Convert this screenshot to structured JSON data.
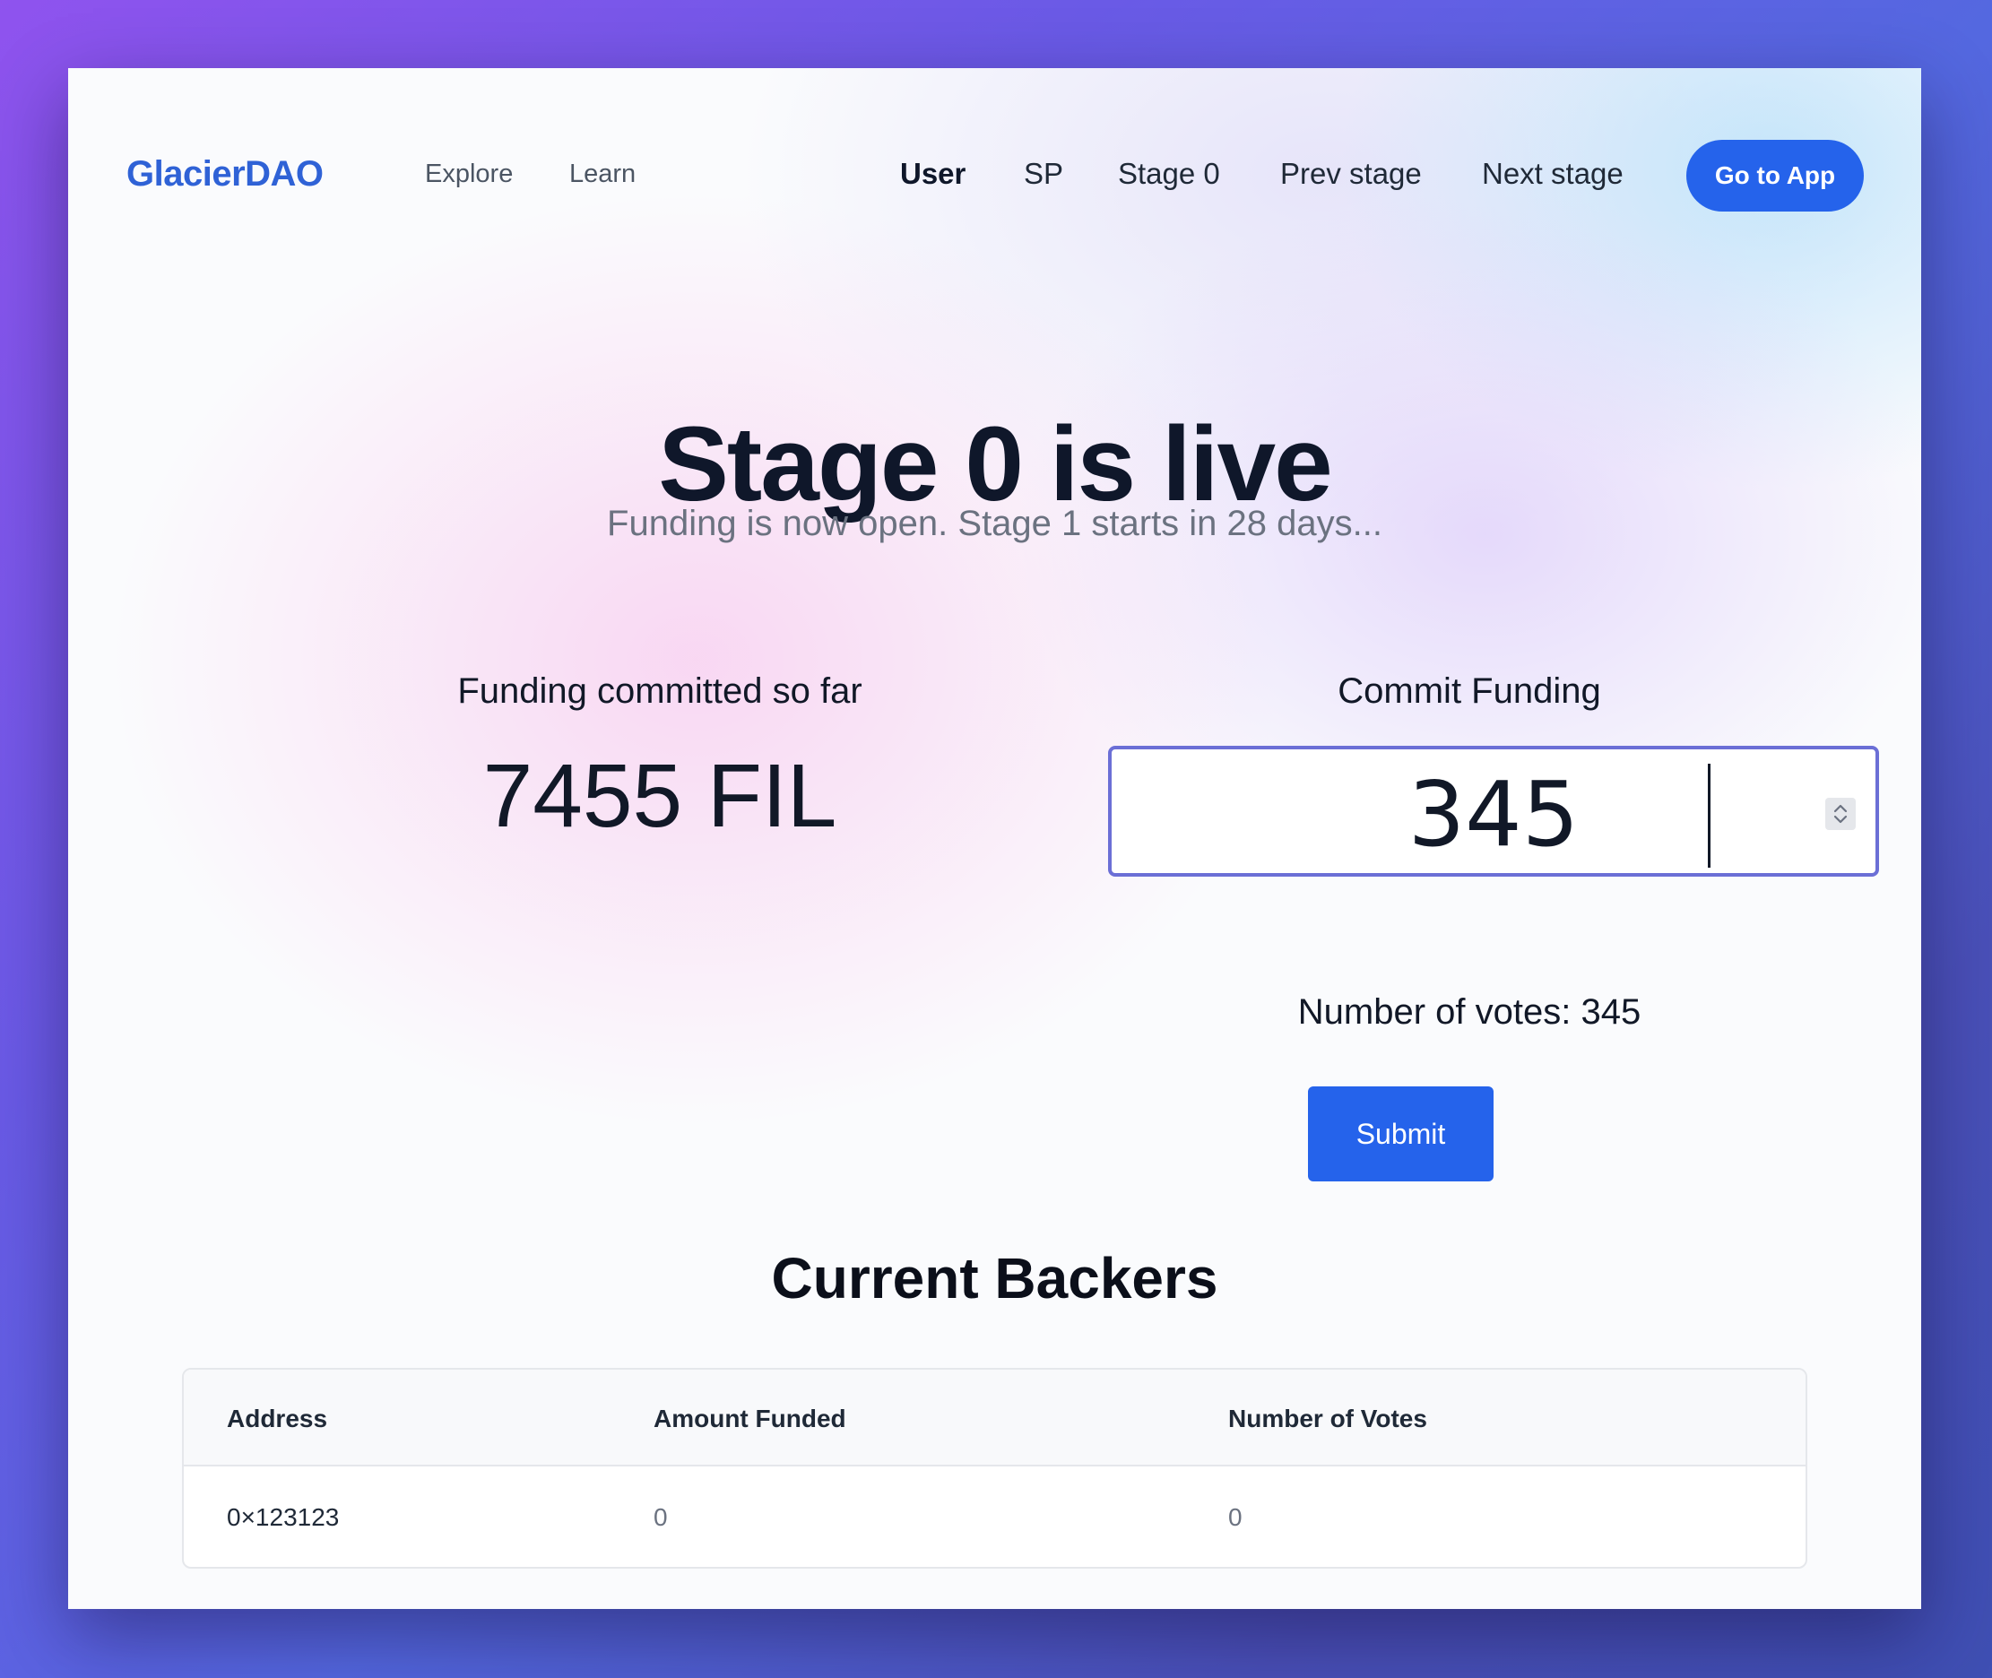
{
  "brand": "GlacierDAO",
  "nav": {
    "left_links": [
      "Explore",
      "Learn"
    ],
    "right_links": [
      "User",
      "SP",
      "Stage 0",
      "Prev stage",
      "Next stage"
    ],
    "active": "User",
    "cta": "Go to App"
  },
  "hero": {
    "title": "Stage 0 is live",
    "subtitle": "Funding is now open. Stage 1 starts in 28 days..."
  },
  "funding": {
    "committed_label": "Funding committed so far",
    "committed_amount": "7455 FIL",
    "commit_label": "Commit Funding",
    "input_value": "345",
    "votes_text": "Number of votes: 345",
    "submit_label": "Submit"
  },
  "backers": {
    "title": "Current Backers",
    "columns": [
      "Address",
      "Amount Funded",
      "Number of Votes"
    ],
    "rows": [
      [
        "0×123123",
        "0",
        "0"
      ]
    ]
  },
  "colors": {
    "accent": "#2563eb",
    "brand": "#2f62d6",
    "input_border": "#6b6fd6"
  },
  "icons": {
    "stepper": "number-stepper-icon"
  }
}
